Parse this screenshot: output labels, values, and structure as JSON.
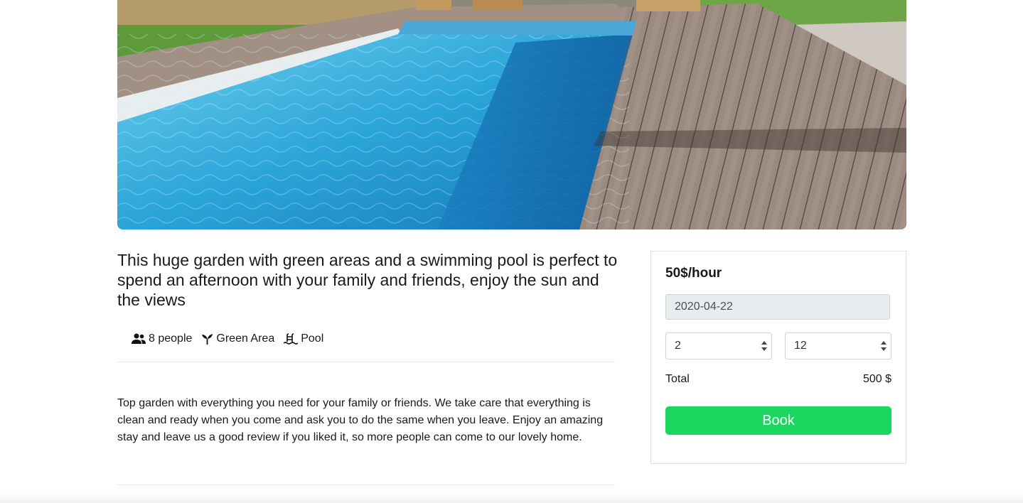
{
  "listing": {
    "hero_image_alt": "swimming-pool-photo",
    "title": "This huge garden with green areas and a swimming pool is perfect to spend an afternoon with your family and friends, enjoy the sun and the views",
    "amenities": [
      {
        "icon": "people-icon",
        "label": "8 people"
      },
      {
        "icon": "sprout-icon",
        "label": "Green Area"
      },
      {
        "icon": "pool-icon",
        "label": "Pool"
      }
    ],
    "description": "Top garden with everything you need for your family or friends. We take care that everything is clean and ready when you come and ask you to do the same when you leave. Enjoy an amazing stay and leave us a good review if you liked it, so more people can come to our lovely home."
  },
  "booking": {
    "price": "50$/hour",
    "date": "2020-04-22",
    "start_hour": "2",
    "end_hour": "12",
    "total_label": "Total",
    "total_value": "500 $",
    "book_label": "Book"
  },
  "colors": {
    "accent": "#1bd760",
    "input_disabled_bg": "#e9ecef"
  }
}
